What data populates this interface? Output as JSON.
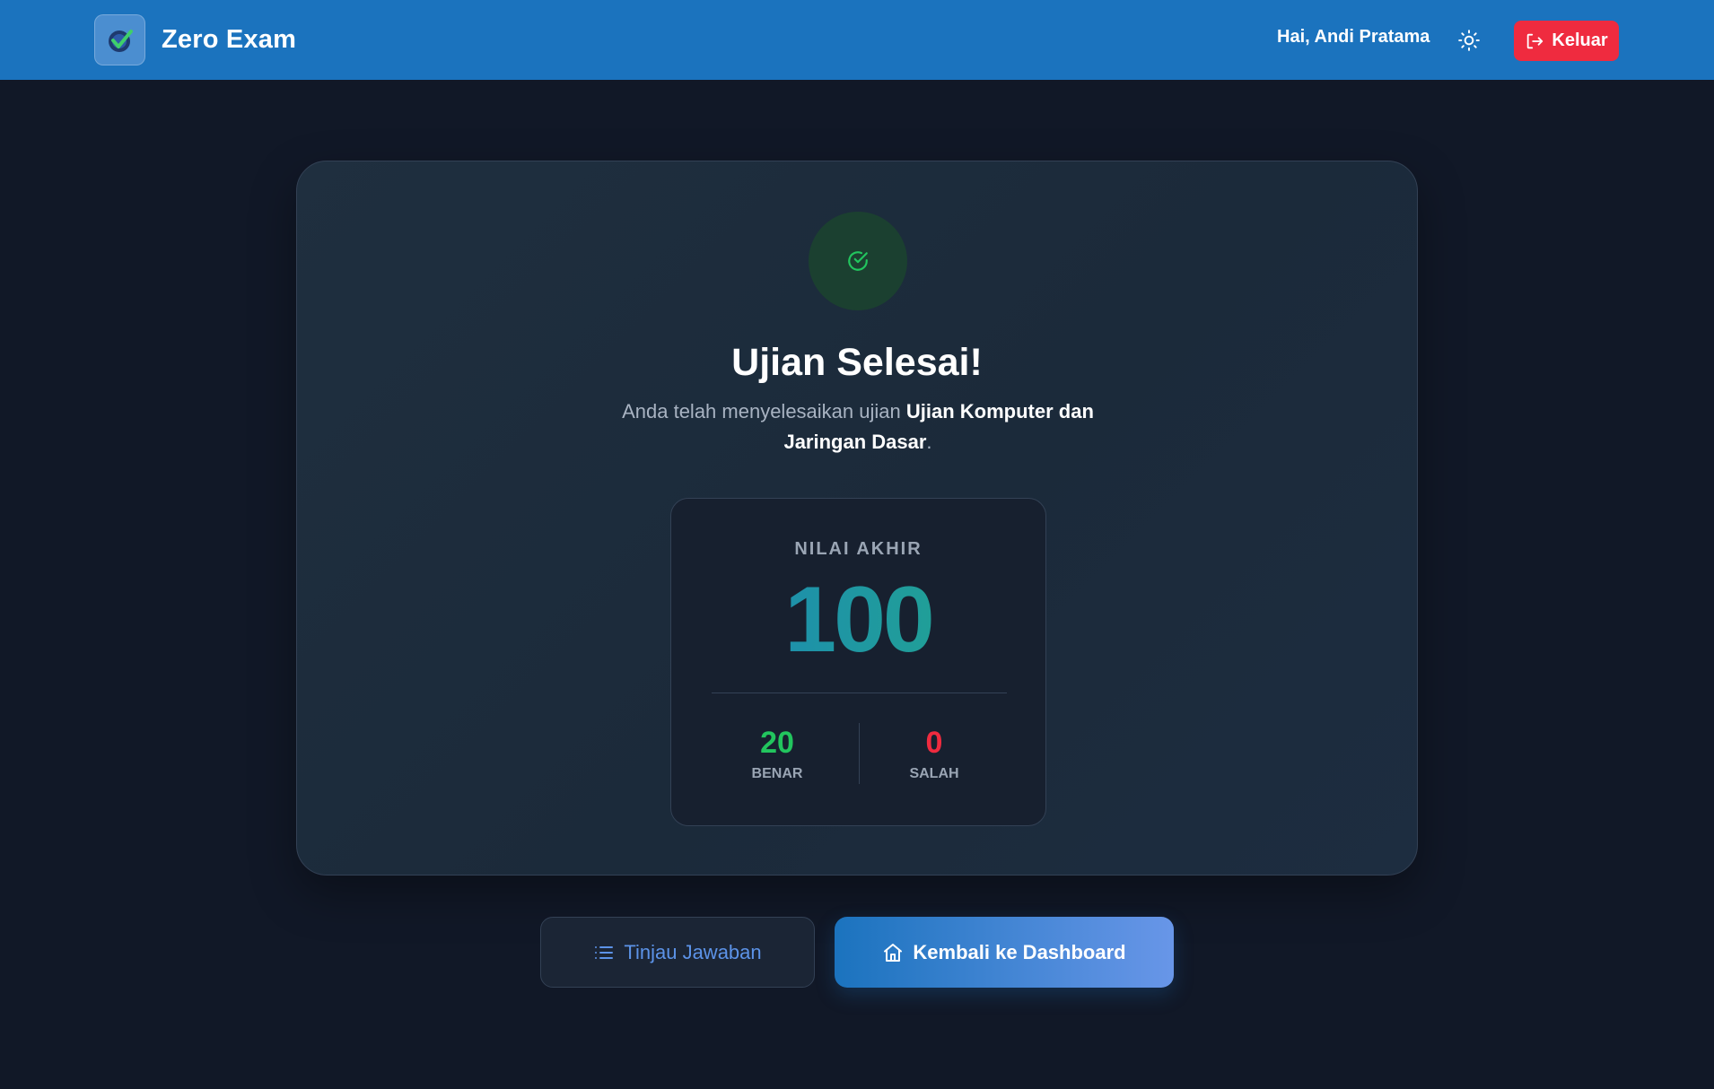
{
  "header": {
    "app_name": "Zero Exam",
    "greeting": "Hai, Andi Pratama",
    "logout_label": "Keluar",
    "colors": {
      "bar": "#1b73be",
      "logout": "#ef2b3f"
    }
  },
  "result": {
    "title": "Ujian Selesai!",
    "description_prefix": "Anda telah menyelesaikan ujian",
    "exam_name": "Ujian Komputer dan Jaringan Dasar",
    "description_suffix": ".",
    "score_label": "NILAI AKHIR",
    "score": "100",
    "correct_count": "20",
    "correct_label": "BENAR",
    "wrong_count": "0",
    "wrong_label": "SALAH",
    "colors": {
      "correct": "#22c55e",
      "wrong": "#ef2b3f",
      "accent": "#22a98a"
    }
  },
  "actions": {
    "review_label": "Tinjau Jawaban",
    "dashboard_label": "Kembali ke Dashboard"
  },
  "icons": {
    "logo": "check-logo-icon",
    "theme": "sun-icon",
    "logout": "logout-icon",
    "success": "check-circle-icon",
    "review": "list-icon",
    "dashboard": "home-icon"
  }
}
